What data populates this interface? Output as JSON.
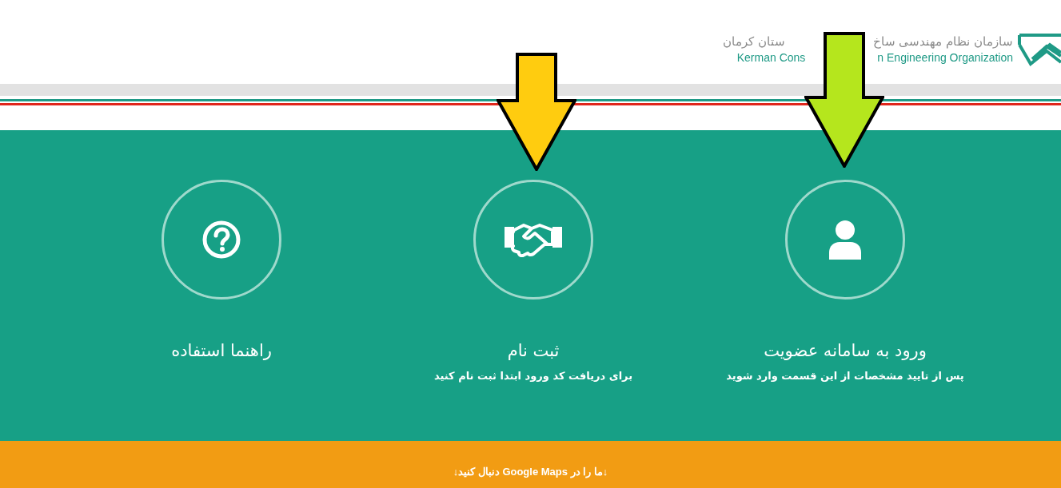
{
  "logo": {
    "title_right": "سازمان نظام مهندسی ساخ",
    "title_left": "ستان کرمان",
    "subtitle_left": "Kerman Cons",
    "subtitle_right": "n Engineering Organization"
  },
  "cards": [
    {
      "kind": "user",
      "title": "ورود به سامانه عضویت",
      "subtitle": "پس از تایید مشخصات از این قسمت وارد شوید"
    },
    {
      "kind": "handshake",
      "title": "ثبت نام",
      "subtitle": "برای دریافت کد ورود ابتدا ثبت نام کنید"
    },
    {
      "kind": "help",
      "title": "راهنما استفاده"
    }
  ],
  "arrows": [
    {
      "color": "#b5e61d"
    },
    {
      "color": "#ffcc0f"
    }
  ],
  "footer": {
    "text": "↓ما را در Google Maps دنبال کنید↓"
  }
}
